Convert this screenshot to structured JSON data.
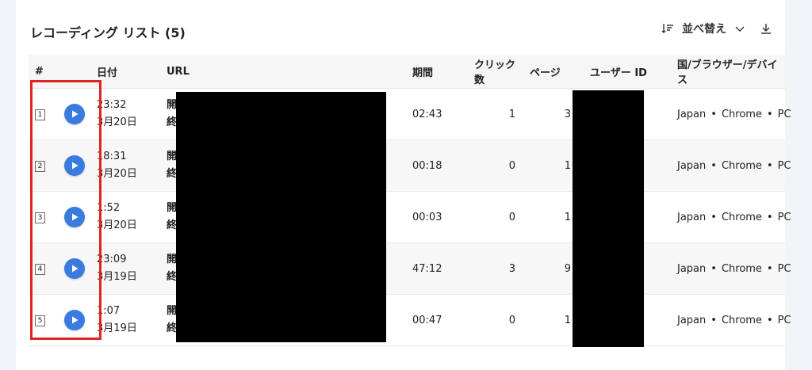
{
  "title": "レコーディング リスト (5)",
  "toolbar": {
    "sort_label": "並べ替え"
  },
  "columns": {
    "num": "#",
    "date": "日付",
    "url": "URL",
    "duration": "期間",
    "clicks": "クリック数",
    "pages": "ページ",
    "user": "ユーザー ID",
    "geo": "国/ブラウザー/デバイス"
  },
  "url_labels": {
    "start": "開始時:",
    "end": "終了時:"
  },
  "rows": [
    {
      "num": "1",
      "time": "23:32",
      "date": "3月20日",
      "duration": "02:43",
      "clicks": "1",
      "pages": "3",
      "country": "Japan",
      "browser": "Chrome",
      "device": "PC"
    },
    {
      "num": "2",
      "time": "18:31",
      "date": "3月20日",
      "duration": "00:18",
      "clicks": "0",
      "pages": "1",
      "country": "Japan",
      "browser": "Chrome",
      "device": "PC"
    },
    {
      "num": "3",
      "time": "1:52",
      "date": "3月20日",
      "duration": "00:03",
      "clicks": "0",
      "pages": "1",
      "country": "Japan",
      "browser": "Chrome",
      "device": "PC"
    },
    {
      "num": "4",
      "time": "23:09",
      "date": "3月19日",
      "duration": "47:12",
      "clicks": "3",
      "pages": "9",
      "country": "Japan",
      "browser": "Chrome",
      "device": "PC"
    },
    {
      "num": "5",
      "time": "1:07",
      "date": "3月19日",
      "duration": "00:47",
      "clicks": "0",
      "pages": "1",
      "country": "Japan",
      "browser": "Chrome",
      "device": "PC"
    }
  ],
  "colors": {
    "play": "#3b7be0",
    "highlight": "#e02424",
    "redaction": "#000000"
  }
}
